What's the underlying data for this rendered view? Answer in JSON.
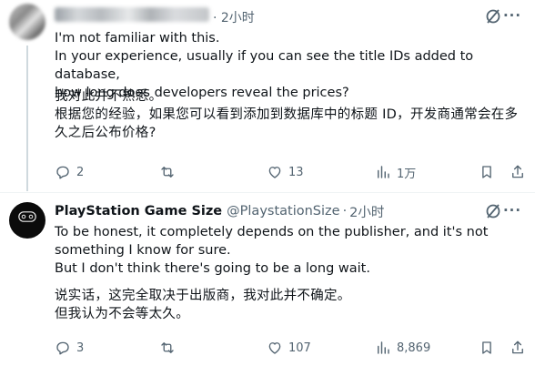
{
  "tweet1": {
    "time": "· 2小时",
    "text_en_1": "I'm not familiar with this.",
    "text_en_2": "In your experience, usually if you can see the title IDs added to database,",
    "text_en_3": "how long does developers reveal the prices?",
    "text_zh_1": "我对此并不熟悉。",
    "text_zh_2": "根据您的经验，如果您可以看到添加到数据库中的标题 ID，开发商通常会在多",
    "text_zh_3": "久之后公布价格?",
    "replies": "2",
    "reposts": "",
    "likes": "13",
    "views": "1万"
  },
  "tweet2": {
    "name": "PlayStation Game Size",
    "handle": "@PlaystationSize",
    "dot": "·",
    "time": "2小时",
    "text_en_1": "To be honest, it completely depends on the publisher, and it's not",
    "text_en_2": "something I know for sure.",
    "text_en_3": "But I don't think there's going to be a long wait.",
    "text_zh_1": "说实话，这完全取决于出版商，我对此并不确定。",
    "text_zh_2": "但我认为不会等太久。",
    "replies": "3",
    "reposts": "",
    "likes": "107",
    "views": "8,869"
  },
  "more_label": "···",
  "icons": [
    "grok-icon",
    "more-icon",
    "reply-icon",
    "repost-icon",
    "like-icon",
    "views-icon",
    "bookmark-icon",
    "share-icon"
  ],
  "colors": {
    "text": "#0f1419",
    "secondary": "#536471",
    "divider": "#eff3f4",
    "thread": "#cfd9de"
  }
}
